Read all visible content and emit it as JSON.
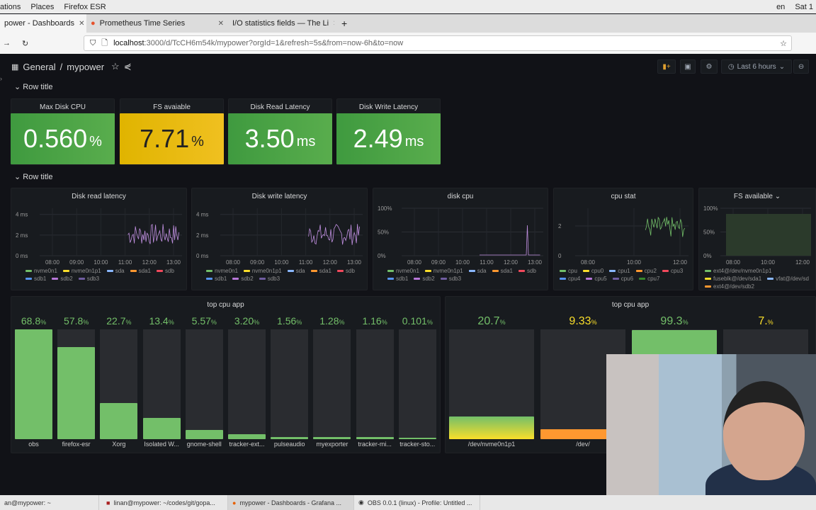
{
  "gnome": {
    "apps": "ations",
    "places": "Places",
    "app": "Firefox ESR",
    "lang": "en",
    "clock": "Sat 1"
  },
  "browser": {
    "tabs": [
      {
        "label": "power - Dashboards",
        "active": true
      },
      {
        "label": "Prometheus Time Series",
        "active": false
      },
      {
        "label": "I/O statistics fields — The Li",
        "active": false
      }
    ],
    "new_tab": "+",
    "url_host": "localhost",
    "url_rest": ":3000/d/TcCH6m54k/mypower?orgId=1&refresh=5s&from=now-6h&to=now"
  },
  "header": {
    "folder": "General",
    "sep": "/",
    "title": "mypower",
    "time_range": "Last 6 hours"
  },
  "rows": [
    "Row title",
    "Row title"
  ],
  "stats": [
    {
      "title": "Max Disk CPU",
      "value": "0.560",
      "unit": "%",
      "color": "#56a64b"
    },
    {
      "title": "FS avaiable",
      "value": "7.71",
      "unit": "%",
      "color": "#e0b400"
    },
    {
      "title": "Disk Read Latency",
      "value": "3.50",
      "unit": "ms",
      "color": "#56a64b"
    },
    {
      "title": "Disk Write Latency",
      "value": "2.49",
      "unit": "ms",
      "color": "#56a64b"
    }
  ],
  "graphs": [
    {
      "title": "Disk read latency",
      "yticks": [
        "4 ms",
        "2 ms",
        "0 ms"
      ],
      "xticks": [
        "08:00",
        "09:00",
        "10:00",
        "11:00",
        "12:00",
        "13:00"
      ],
      "legend": [
        [
          "nvme0n1",
          "#73bf69"
        ],
        [
          "nvme0n1p1",
          "#fade2a"
        ],
        [
          "sda",
          "#8ab8ff"
        ],
        [
          "sda1",
          "#ff9830"
        ],
        [
          "sdb",
          "#f2495c"
        ],
        [
          "sdb1",
          "#5794f2"
        ],
        [
          "sdb2",
          "#b877d9"
        ],
        [
          "sdb3",
          "#705da0"
        ]
      ]
    },
    {
      "title": "Disk write latency",
      "yticks": [
        "4 ms",
        "2 ms",
        "0 ms"
      ],
      "xticks": [
        "08:00",
        "09:00",
        "10:00",
        "11:00",
        "12:00",
        "13:00"
      ],
      "legend": [
        [
          "nvme0n1",
          "#73bf69"
        ],
        [
          "nvme0n1p1",
          "#fade2a"
        ],
        [
          "sda",
          "#8ab8ff"
        ],
        [
          "sda1",
          "#ff9830"
        ],
        [
          "sdb",
          "#f2495c"
        ],
        [
          "sdb1",
          "#5794f2"
        ],
        [
          "sdb2",
          "#b877d9"
        ],
        [
          "sdb3",
          "#705da0"
        ]
      ]
    },
    {
      "title": "disk cpu",
      "yticks": [
        "100%",
        "50%",
        "0%"
      ],
      "xticks": [
        "08:00",
        "09:00",
        "10:00",
        "11:00",
        "12:00",
        "13:00"
      ],
      "legend": [
        [
          "nvme0n1",
          "#73bf69"
        ],
        [
          "nvme0n1p1",
          "#fade2a"
        ],
        [
          "sda",
          "#8ab8ff"
        ],
        [
          "sda1",
          "#ff9830"
        ],
        [
          "sdb",
          "#f2495c"
        ],
        [
          "sdb1",
          "#5794f2"
        ],
        [
          "sdb2",
          "#b877d9"
        ],
        [
          "sdb3",
          "#705da0"
        ]
      ]
    },
    {
      "title": "cpu stat",
      "yticks": [
        "2",
        "0"
      ],
      "xticks": [
        "08:00",
        "10:00",
        "12:00"
      ],
      "legend": [
        [
          "cpu",
          "#73bf69"
        ],
        [
          "cpu0",
          "#fade2a"
        ],
        [
          "cpu1",
          "#8ab8ff"
        ],
        [
          "cpu2",
          "#ff9830"
        ],
        [
          "cpu3",
          "#f2495c"
        ],
        [
          "cpu4",
          "#5794f2"
        ],
        [
          "cpu5",
          "#b877d9"
        ],
        [
          "cpu6",
          "#705da0"
        ],
        [
          "cpu7",
          "#37872d"
        ]
      ]
    },
    {
      "title": "FS available ⌄",
      "yticks": [
        "100%",
        "50%",
        "0%"
      ],
      "xticks": [
        "08:00",
        "10:00",
        "12:00"
      ],
      "legend": [
        [
          "ext4@/dev/nvme0n1p1",
          "#73bf69"
        ],
        [
          "fuseblk@/dev/sda1",
          "#fade2a"
        ],
        [
          "vfat@/dev/sd",
          "#8ab8ff"
        ],
        [
          "ext4@/dev/sdb2",
          "#ff9830"
        ]
      ]
    }
  ],
  "bars1": {
    "title": "top cpu app",
    "items": [
      {
        "label": "obs",
        "value": "68.8",
        "pct": 68.8
      },
      {
        "label": "firefox-esr",
        "value": "57.8",
        "pct": 57.8
      },
      {
        "label": "Xorg",
        "value": "22.7",
        "pct": 22.7
      },
      {
        "label": "Isolated W...",
        "value": "13.4",
        "pct": 13.4
      },
      {
        "label": "gnome-shell",
        "value": "5.57",
        "pct": 5.57
      },
      {
        "label": "tracker-ext...",
        "value": "3.20",
        "pct": 3.2
      },
      {
        "label": "pulseaudio",
        "value": "1.56",
        "pct": 1.56
      },
      {
        "label": "myexporter",
        "value": "1.28",
        "pct": 1.28
      },
      {
        "label": "tracker-mi...",
        "value": "1.16",
        "pct": 1.16
      },
      {
        "label": "tracker-sto...",
        "value": "0.101",
        "pct": 0.101
      }
    ],
    "max": 68.8,
    "unit": "%",
    "color": "#73bf69"
  },
  "bars2": {
    "title": "top cpu app",
    "items": [
      {
        "label": "/dev/nvme0n1p1",
        "value": "20.7",
        "pct": 20.7,
        "color": "#73bf69"
      },
      {
        "label": "/dev/",
        "value": "9.33",
        "pct": 9.33,
        "color": "#fade2a"
      },
      {
        "label": "",
        "value": "99.3",
        "pct": 99.3,
        "color": "#73bf69"
      },
      {
        "label": "",
        "value": "7.",
        "pct": 7.7,
        "color": "#fade2a"
      }
    ],
    "unit": "%"
  },
  "taskbar": [
    "an@mypower: ~",
    "linan@mypower: ~/codes/git/gopa...",
    "mypower - Dashboards - Grafana ...",
    "OBS 0.0.1 (linux) - Profile: Untitled ..."
  ]
}
